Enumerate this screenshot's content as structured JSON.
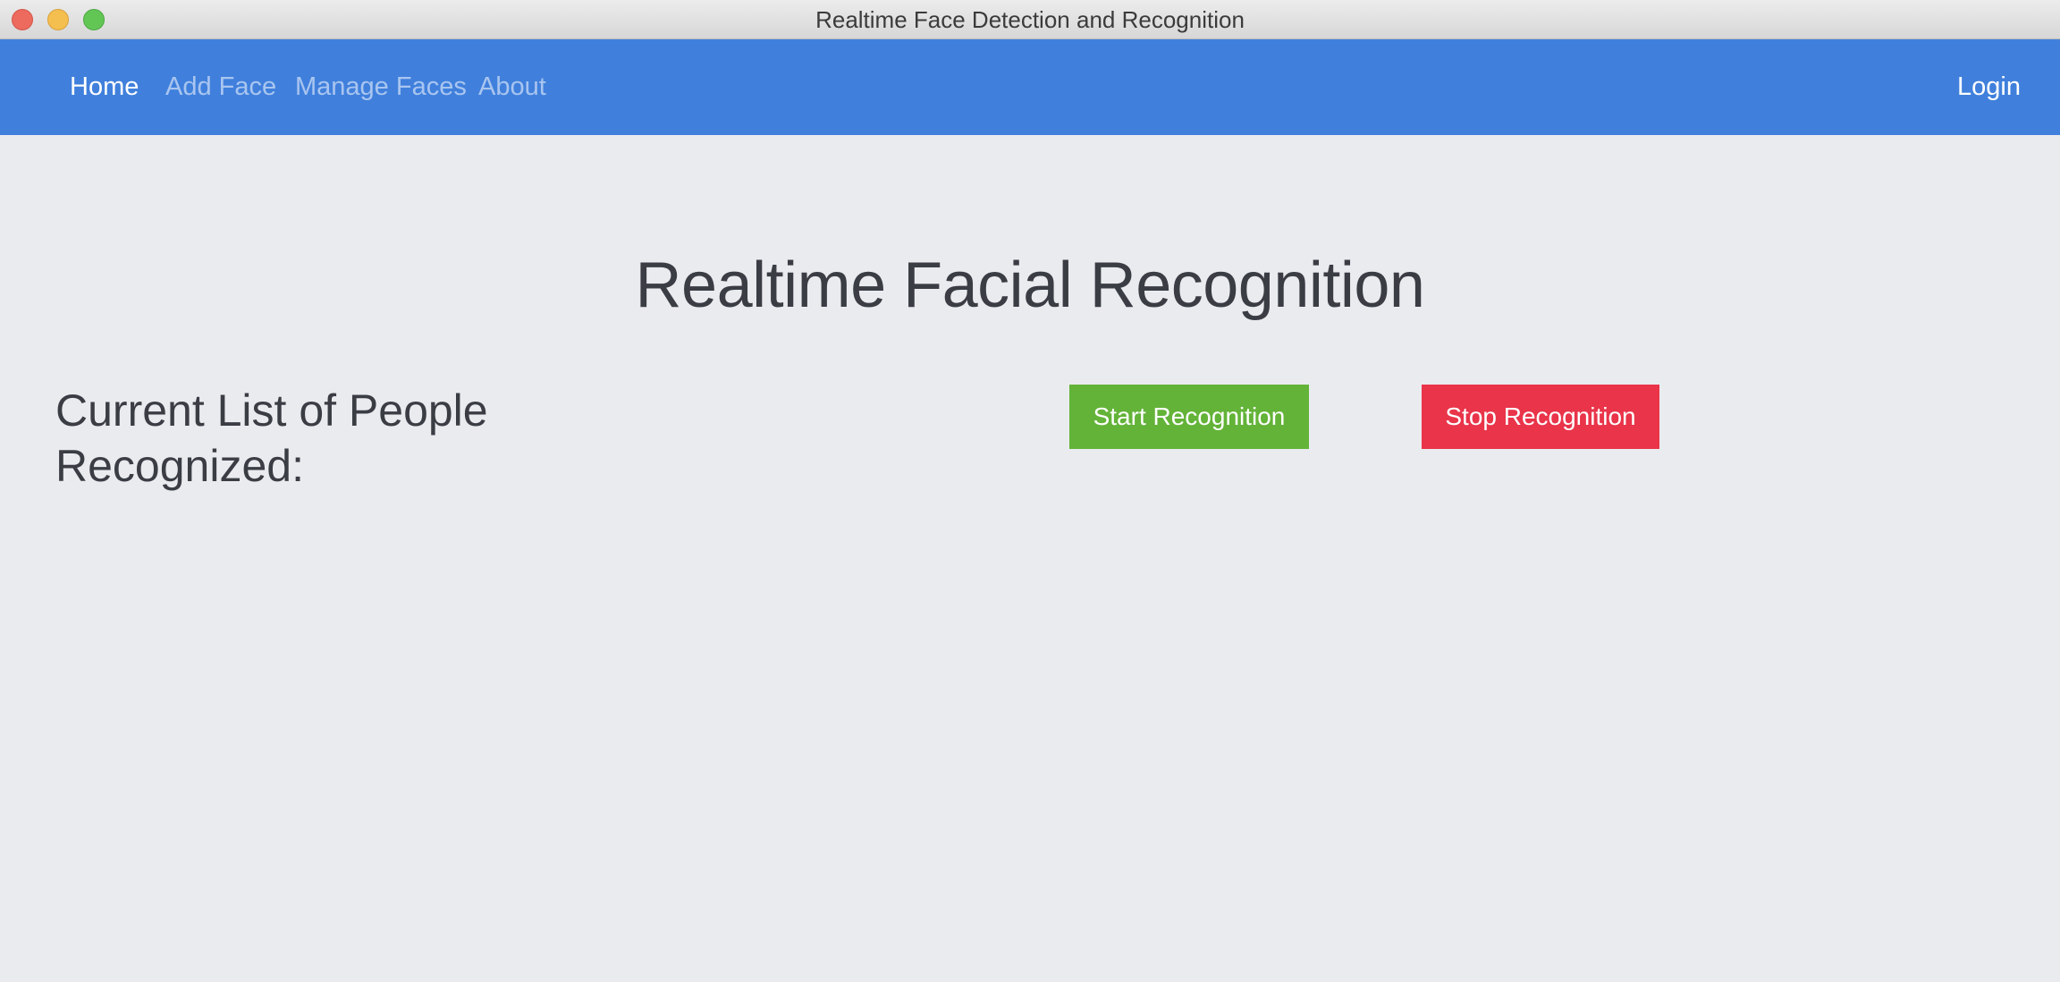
{
  "window": {
    "title": "Realtime Face Detection and Recognition"
  },
  "navbar": {
    "items": [
      {
        "label": "Home",
        "active": true
      },
      {
        "label": "Add Face",
        "active": false
      },
      {
        "label": "Manage Faces",
        "active": false
      },
      {
        "label": "About",
        "active": false
      }
    ],
    "login_label": "Login"
  },
  "main": {
    "title": "Realtime Facial Recognition",
    "people_heading": "Current List of People Recognized:",
    "people": [],
    "start_button_label": "Start Recognition",
    "stop_button_label": "Stop Recognition"
  },
  "colors": {
    "navbar": "#4080dc",
    "background": "#eaebef",
    "start_button": "#63b338",
    "stop_button": "#e9344a"
  }
}
